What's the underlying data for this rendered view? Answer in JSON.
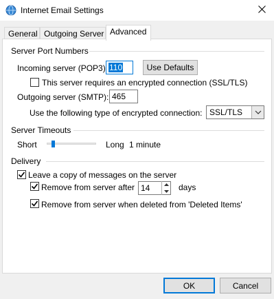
{
  "window": {
    "title": "Internet Email Settings",
    "title_icon": "globe-mail-icon",
    "close_icon": "close-icon"
  },
  "tabs": [
    {
      "label": "General",
      "active": false
    },
    {
      "label": "Outgoing Server",
      "active": false
    },
    {
      "label": "Advanced",
      "active": true
    }
  ],
  "server_ports": {
    "group_label": "Server Port Numbers",
    "incoming_label": "Incoming server (POP3):",
    "incoming_value": "110",
    "use_defaults_label": "Use Defaults",
    "ssl_checkbox_label": "This server requires an encrypted connection (SSL/TLS)",
    "ssl_checked": false,
    "outgoing_label": "Outgoing server (SMTP):",
    "outgoing_value": "465",
    "encryption_label": "Use the following type of encrypted connection:",
    "encryption_value": "SSL/TLS"
  },
  "timeouts": {
    "group_label": "Server Timeouts",
    "short_label": "Short",
    "long_label": "Long",
    "value_label": "1 minute",
    "slider_level": 0.1
  },
  "delivery": {
    "group_label": "Delivery",
    "leave_copy_label": "Leave a copy of messages on the server",
    "leave_copy_checked": true,
    "remove_after_label": "Remove from server after",
    "remove_after_checked": true,
    "days_value": "14",
    "days_label": "days",
    "remove_deleted_label": "Remove from server when deleted from 'Deleted Items'",
    "remove_deleted_checked": true
  },
  "footer": {
    "ok_label": "OK",
    "cancel_label": "Cancel"
  },
  "colors": {
    "accent": "#0078d7",
    "window_bg": "#f0f0f0",
    "panel_bg": "#ffffff"
  }
}
